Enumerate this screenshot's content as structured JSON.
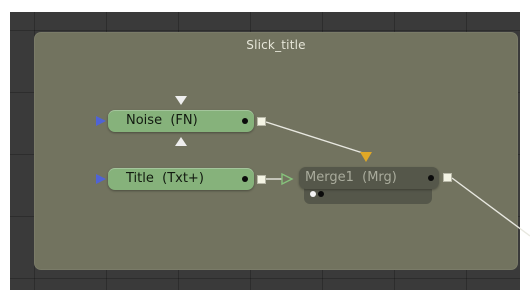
{
  "flow": {
    "group_title": "Slick_title",
    "nodes": {
      "noise": "Noise  (FN)",
      "title": "Title  (Txt+)",
      "merge": "Merge1  (Mrg)"
    }
  },
  "colors": {
    "tool_node": "#86b27b",
    "merge_node": "#55574a",
    "group_bg": "#72735f",
    "canvas_bg": "#3a3a3a",
    "wire": "#e8e8e0",
    "input_arrow": "#4f63d6",
    "fg_arrow": "#e0a826",
    "mask_arrow": "#4f63d6"
  }
}
